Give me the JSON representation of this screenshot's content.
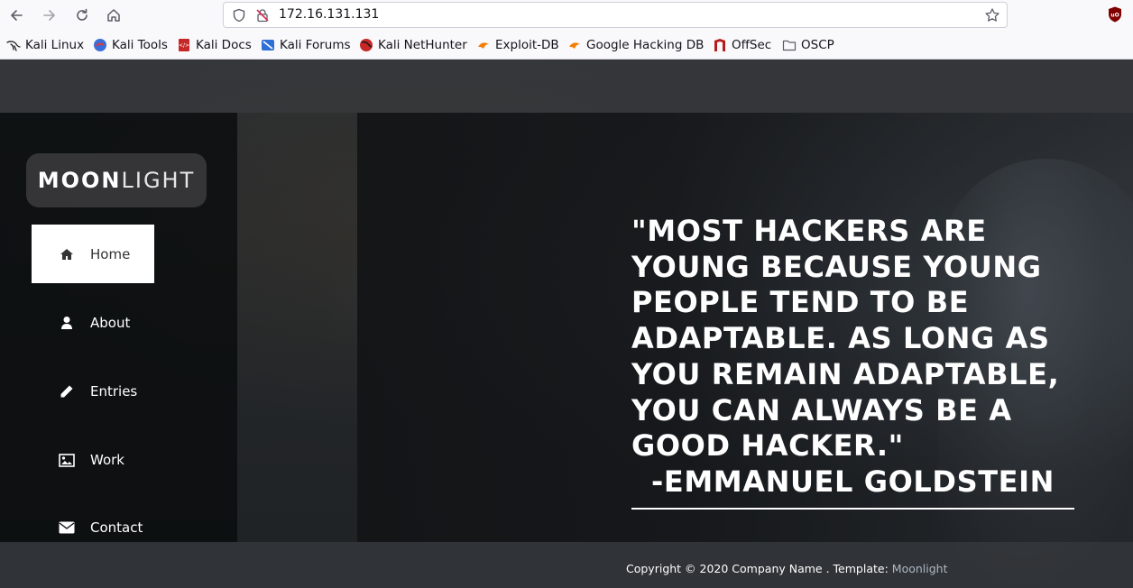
{
  "browser": {
    "url": "172.16.131.131",
    "bookmarks": [
      {
        "label": "Kali Linux",
        "icon": "kali-dragon-icon"
      },
      {
        "label": "Kali Tools",
        "icon": "kali-tools-icon"
      },
      {
        "label": "Kali Docs",
        "icon": "kali-docs-icon"
      },
      {
        "label": "Kali Forums",
        "icon": "kali-forums-icon"
      },
      {
        "label": "Kali NetHunter",
        "icon": "kali-nethunter-icon"
      },
      {
        "label": "Exploit-DB",
        "icon": "exploit-db-icon"
      },
      {
        "label": "Google Hacking DB",
        "icon": "ghdb-icon"
      },
      {
        "label": "OffSec",
        "icon": "offsec-icon"
      },
      {
        "label": "OSCP",
        "icon": "folder-icon"
      }
    ]
  },
  "site": {
    "logo_bold": "MOON",
    "logo_light": "LIGHT",
    "menu": [
      {
        "label": "Home",
        "icon": "home-icon",
        "active": true
      },
      {
        "label": "About",
        "icon": "user-icon",
        "active": false
      },
      {
        "label": "Entries",
        "icon": "pencil-icon",
        "active": false
      },
      {
        "label": "Work",
        "icon": "image-icon",
        "active": false
      },
      {
        "label": "Contact",
        "icon": "envelope-icon",
        "active": false
      }
    ],
    "quote_lines": [
      "\"MOST HACKERS ARE",
      "YOUNG BECAUSE YOUNG",
      "PEOPLE TEND TO BE",
      "ADAPTABLE. AS LONG AS",
      "YOU REMAIN ADAPTABLE,",
      "YOU CAN ALWAYS BE A",
      "GOOD HACKER.\""
    ],
    "quote_author": "-EMMANUEL GOLDSTEIN",
    "footer_text": "Copyright © 2020 Company Name . Template: ",
    "footer_link": "Moonlight"
  },
  "colors": {
    "menu_active_bg": "#ffffff",
    "footer_link": "#aeb8c2",
    "ublock_red": "#800000"
  }
}
